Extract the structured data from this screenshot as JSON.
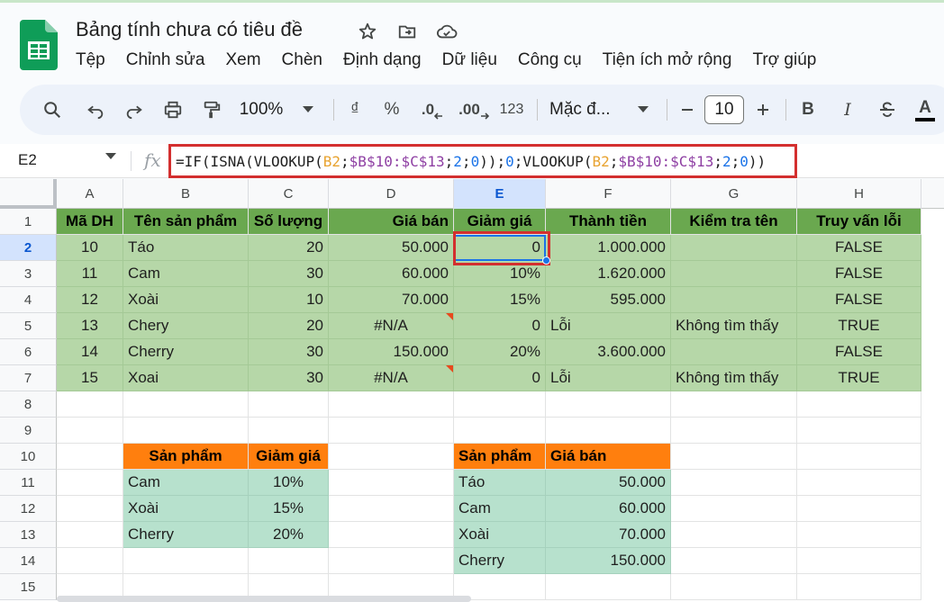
{
  "doc": {
    "title": "Bảng tính chưa có tiêu đề"
  },
  "menu": [
    "Tệp",
    "Chỉnh sửa",
    "Xem",
    "Chèn",
    "Định dạng",
    "Dữ liệu",
    "Công cụ",
    "Tiện ích mở rộng",
    "Trợ giúp"
  ],
  "toolbar": {
    "zoom": "100%",
    "currency": "₫",
    "percent": "%",
    "dec_decrease": ".0",
    "dec_increase": ".00",
    "number_format": "123",
    "font": "Mặc đ...",
    "font_size": "10",
    "bold": "B",
    "italic": "I",
    "text_color": "A"
  },
  "formula_bar": {
    "cell_ref": "E2",
    "fx": "fx",
    "parts": [
      "=IF(ISNA(VLOOKUP(",
      "B2",
      ";",
      "$B$10:$C$13",
      ";",
      "2",
      ";",
      "0",
      "));",
      "0",
      ";VLOOKUP(",
      "B2",
      ";",
      "$B$10:$C$13",
      ";",
      "2",
      ";",
      "0",
      "))"
    ]
  },
  "columns": [
    "A",
    "B",
    "C",
    "D",
    "E",
    "F",
    "G",
    "H"
  ],
  "rows": [
    "1",
    "2",
    "3",
    "4",
    "5",
    "6",
    "7",
    "8",
    "9",
    "10",
    "11",
    "12",
    "13",
    "14",
    "15"
  ],
  "main_table": {
    "headers": [
      "Mã DH",
      "Tên sản phẩm",
      "Số lượng",
      "Giá bán",
      "Giảm giá",
      "Thành tiền",
      "Kiểm tra tên",
      "Truy vấn lỗi"
    ],
    "rows": [
      [
        "10",
        "Táo",
        "20",
        "50.000",
        "0",
        "1.000.000",
        "",
        "FALSE"
      ],
      [
        "11",
        "Cam",
        "30",
        "60.000",
        "10%",
        "1.620.000",
        "",
        "FALSE"
      ],
      [
        "12",
        "Xoài",
        "10",
        "70.000",
        "15%",
        "595.000",
        "",
        "FALSE"
      ],
      [
        "13",
        "Chery",
        "20",
        "#N/A",
        "0",
        "Lỗi",
        "Không tìm thấy",
        "TRUE"
      ],
      [
        "14",
        "Cherry",
        "30",
        "150.000",
        "20%",
        "3.600.000",
        "",
        "FALSE"
      ],
      [
        "15",
        "Xoai",
        "30",
        "#N/A",
        "0",
        "Lỗi",
        "Không tìm thấy",
        "TRUE"
      ]
    ]
  },
  "discount_table": {
    "headers": [
      "Sản phẩm",
      "Giảm giá"
    ],
    "rows": [
      [
        "Cam",
        "10%"
      ],
      [
        "Xoài",
        "15%"
      ],
      [
        "Cherry",
        "20%"
      ]
    ]
  },
  "price_table": {
    "headers": [
      "Sản phẩm",
      "Giá bán"
    ],
    "rows": [
      [
        "Táo",
        "50.000"
      ],
      [
        "Cam",
        "60.000"
      ],
      [
        "Xoài",
        "70.000"
      ],
      [
        "Cherry",
        "150.000"
      ]
    ]
  },
  "icons": {
    "app_logo": "sheets-logo-icon",
    "star": "star-icon",
    "move": "move-folder-icon",
    "cloud": "cloud-saved-icon",
    "search": "search-icon",
    "undo": "undo-icon",
    "redo": "redo-icon",
    "print": "print-icon",
    "paint": "paint-format-icon"
  },
  "colors": {
    "green_header": "#6aa84f",
    "green_body": "#b6d7a8",
    "orange_header": "#ff7f0e",
    "teal_body": "#b7e1cd",
    "highlight": "#d32f2f",
    "accent": "#1a73e8"
  }
}
